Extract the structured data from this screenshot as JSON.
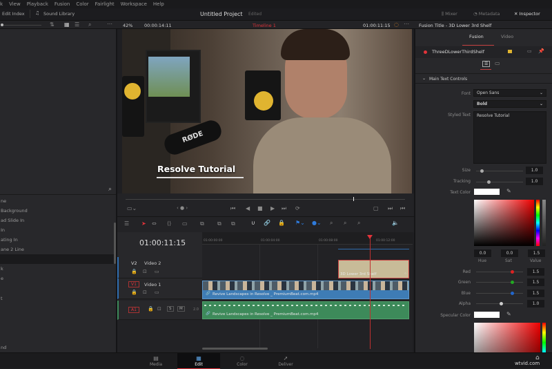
{
  "menu": [
    "k",
    "View",
    "Playback",
    "Fusion",
    "Color",
    "Fairlight",
    "Workspace",
    "Help"
  ],
  "toolbar": {
    "edit_index": "Edit Index",
    "sound_library": "Sound Library",
    "project_title": "Untitled Project",
    "project_status": "Edited",
    "mixer": "Mixer",
    "metadata": "Metadata",
    "inspector": "Inspector"
  },
  "viewer_header": {
    "zoom": "42%",
    "source_timecode": "00:00:14:11",
    "timeline_name": "Timeline 1",
    "record_timecode": "01:00:11:15"
  },
  "viewer": {
    "overlay_title": "Resolve Tutorial",
    "mic_brand": "RØDE"
  },
  "effects_list": [
    "ne",
    "Background",
    "ad Slide In",
    "In",
    "ating In",
    "ane 2 Line",
    "",
    "k",
    "e",
    "",
    "t",
    "nd"
  ],
  "timeline": {
    "timecode": "01:00:11:15",
    "ruler": [
      "01:00:00:00",
      "01:00:04:00",
      "01:00:08:00",
      "01:00:12:00"
    ],
    "tracks": [
      {
        "id": "V2",
        "name": "Video 2"
      },
      {
        "id": "V1",
        "name": "Video 1"
      },
      {
        "id": "A1",
        "name": "",
        "channels": "2.0",
        "solo": "S",
        "mute": "M"
      }
    ],
    "title_clip": "3D Lower 3rd Shelf",
    "video_clip": "Revive Landscapes in Resolve _ PremiumBeat.com.mp4",
    "audio_clip": "Revive Landscapes in Resolve _ PremiumBeat.com.mp4",
    "playhead_fraction": 0.81
  },
  "inspector": {
    "title": "Fusion Title - 3D Lower 3rd Shelf",
    "tabs": [
      "Fusion",
      "Video"
    ],
    "node_name": "ThreeDLowerThirdShelf",
    "section": "Main Text Controls",
    "font_label": "Font",
    "font": "Open Sans",
    "style": "Bold",
    "styled_text_label": "Styled Text",
    "styled_text": "Resolve Tutorial",
    "size_label": "Size",
    "size": "1.0",
    "tracking_label": "Tracking",
    "tracking": "1.0",
    "text_color_label": "Text Color",
    "hue": "0.0",
    "sat": "0.0",
    "value": "1.5",
    "hue_label": "Hue",
    "sat_label": "Sat",
    "value_label": "Value",
    "red_label": "Red",
    "red": "1.5",
    "green_label": "Green",
    "green": "1.5",
    "blue_label": "Blue",
    "blue": "1.5",
    "alpha_label": "Alpha",
    "alpha": "1.0",
    "specular_label": "Specular Color"
  },
  "bottom_nav": [
    "Media",
    "Edit",
    "Color",
    "Deliver"
  ],
  "watermark": "wtvid.com",
  "colors": {
    "accent_red": "#e2333a",
    "video_clip": "#3e7cb5",
    "audio_clip": "#3d8a5a",
    "title_clip": "#c8bb98"
  }
}
